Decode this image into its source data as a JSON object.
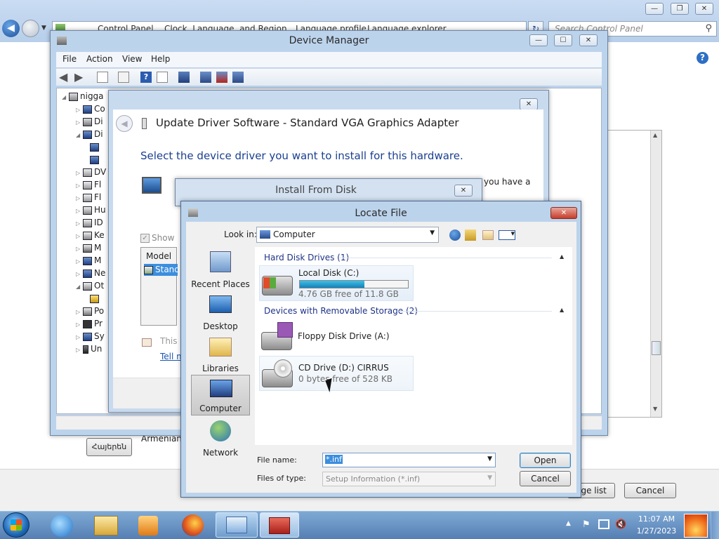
{
  "explorer": {
    "breadcrumb": [
      "Control Panel",
      "Clock, Language, and Region",
      "Language profile",
      "Language explorer"
    ],
    "search_placeholder": "Search Control Panel",
    "bottom_left_label": "Armenian",
    "bottom_button": "Հայերեն",
    "page_list_button": "age list",
    "cancel_button": "Cancel"
  },
  "device_manager": {
    "title": "Device Manager",
    "menu": [
      "File",
      "Action",
      "View",
      "Help"
    ],
    "tree_root": "nigga",
    "tree_items": [
      "Co",
      "Di",
      "Di",
      "",
      "",
      "DV",
      "Fl",
      "Fl",
      "Hu",
      "ID",
      "Ke",
      "M",
      "M",
      "Ne",
      "Ot",
      "",
      "Po",
      "Pr",
      "Sy",
      "Un"
    ]
  },
  "update_driver": {
    "title": "Update Driver Software - Standard VGA Graphics Adapter",
    "heading": "Select the device driver you want to install for this hardware.",
    "right_text": "you have a",
    "show_label": "Show",
    "model_header": "Model",
    "model_item": "Stand",
    "note_text": "This",
    "tell_link": "Tell m"
  },
  "install_from_disk": {
    "title": "Install From Disk"
  },
  "locate_file": {
    "title": "Locate File",
    "look_in_label": "Look in:",
    "look_in_value": "Computer",
    "places": [
      "Recent Places",
      "Desktop",
      "Libraries",
      "Computer",
      "Network"
    ],
    "groups": {
      "hdd": "Hard Disk Drives (1)",
      "removable": "Devices with Removable Storage (2)"
    },
    "drives": {
      "c_name": "Local Disk (C:)",
      "c_free": "4.76 GB free of 11.8 GB",
      "c_used_fraction": 0.6,
      "a_name": "Floppy Disk Drive (A:)",
      "d_name": "CD Drive (D:) CIRRUS",
      "d_free": "0 bytes free of 528 KB"
    },
    "file_name_label": "File name:",
    "file_name_value": "*.inf",
    "files_of_type_label": "Files of type:",
    "files_of_type_value": "Setup Information (*.inf)",
    "open_button": "Open",
    "cancel_button": "Cancel"
  },
  "taskbar": {
    "time": "11:07 AM",
    "date": "1/27/2023"
  }
}
